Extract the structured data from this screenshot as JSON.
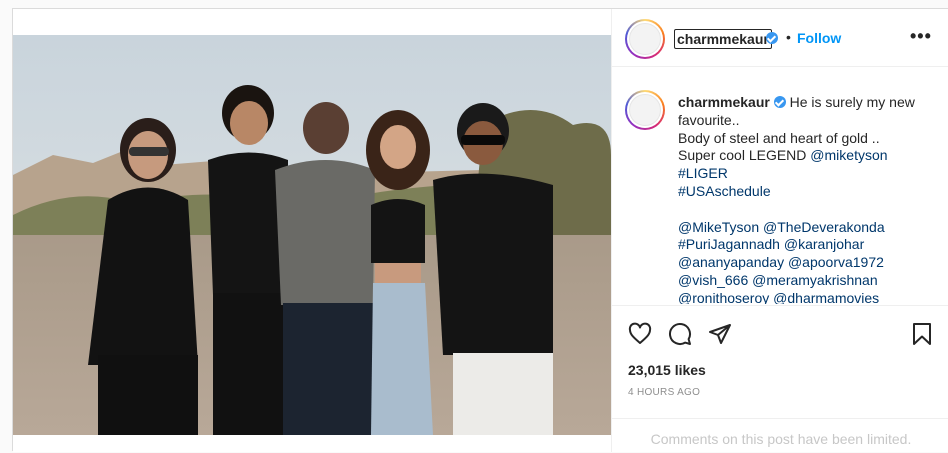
{
  "post": {
    "username": "charmmekaur",
    "follow_label": "Follow",
    "dot": "•",
    "more_label": "•••",
    "caption": {
      "username": "charmmekaur",
      "text_line1": "He is surely my new",
      "text_line2": "favourite..",
      "text_line3": "Body of steel and heart of gold ..",
      "text_line4_prefix": "Super cool LEGEND",
      "mention_miketyson": "@miketyson",
      "hashtag_liger": "#LIGER",
      "hashtag_usaschedule": "#USAschedule",
      "mention_mike": "@MikeTyson",
      "mention_deverakonda": "@TheDeverakonda",
      "hashtag_puri": "#PuriJagannadh",
      "mention_karan": "@karanjohar",
      "mention_ananya": "@ananyapanday",
      "mention_apoorva": "@apoorva1972",
      "mention_vish": "@vish_666",
      "mention_meramya": "@meramyakrishnan",
      "mention_ronit": "@ronithoseroy",
      "mention_dharma": "@dharmamovies"
    },
    "likes": "23,015 likes",
    "time": "4 HOURS AGO",
    "comments_limited": "Comments on this post have been limited."
  },
  "icons": {
    "verified": "verified-badge-icon",
    "like": "heart-icon",
    "comment": "comment-icon",
    "share": "paper-plane-icon",
    "save": "bookmark-icon"
  },
  "colors": {
    "accent": "#0095f6",
    "mention": "#00376b",
    "verified": "#3897f0",
    "muted": "#8e8e8e"
  }
}
